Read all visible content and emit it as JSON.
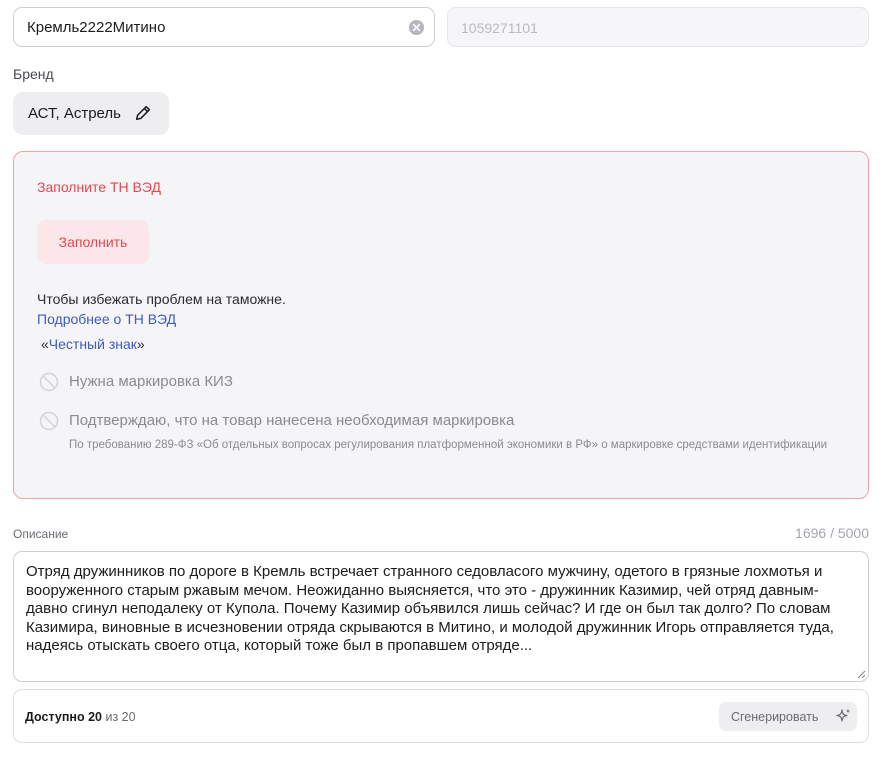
{
  "product": {
    "name_value": "Кремль2222Митино",
    "code_placeholder": "1059271101"
  },
  "brand": {
    "label": "Бренд",
    "value": "АСТ, Астрель"
  },
  "tnved": {
    "title": "Заполните ТН ВЭД",
    "fill_button": "Заполнить",
    "hint": "Чтобы избежать проблем на таможне.",
    "more_link": "Подробнее о ТН ВЭД",
    "honest_sign_open": "«",
    "honest_sign_link": "Честный знак",
    "honest_sign_close": "»",
    "checkbox_kiz": "Нужна маркировка КИЗ",
    "checkbox_confirm": "Подтверждаю, что на товар нанесена необходимая маркировка",
    "confirm_note": "По требованию 289-ФЗ «Об отдельных вопросах регулирования платформенной экономики в РФ» о маркировке средствами идентификации"
  },
  "description": {
    "label": "Описание",
    "counter": "1696 / 5000",
    "text": "Отряд дружинников по дороге в Кремль встречает странного седовласого мужчину, одетого в грязные лохмотья и вооруженного старым ржавым мечом. Неожиданно выясняется, что это - дружинник Казимир, чей отряд давным-давно сгинул неподалеку от Купола. Почему Казимир объявился лишь сейчас? И где он был так долго? По словам Казимира, виновные в исчезновении отряда скрываются в Митино, и молодой дружинник Игорь отправляется туда, надеясь отыскать своего отца, который тоже был в пропавшем отряде..."
  },
  "generator": {
    "available_label": "Доступно 20",
    "of_label": "из 20",
    "button": "Сгенерировать"
  },
  "colors": {
    "accent_red": "#e2484f",
    "link_blue": "#3e5bbf",
    "warning_border": "#f0a3a8"
  },
  "icons": [
    "clear-icon",
    "pencil-icon",
    "checkbox-disabled-icon",
    "resize-grip-icon",
    "sparkle-icon"
  ]
}
